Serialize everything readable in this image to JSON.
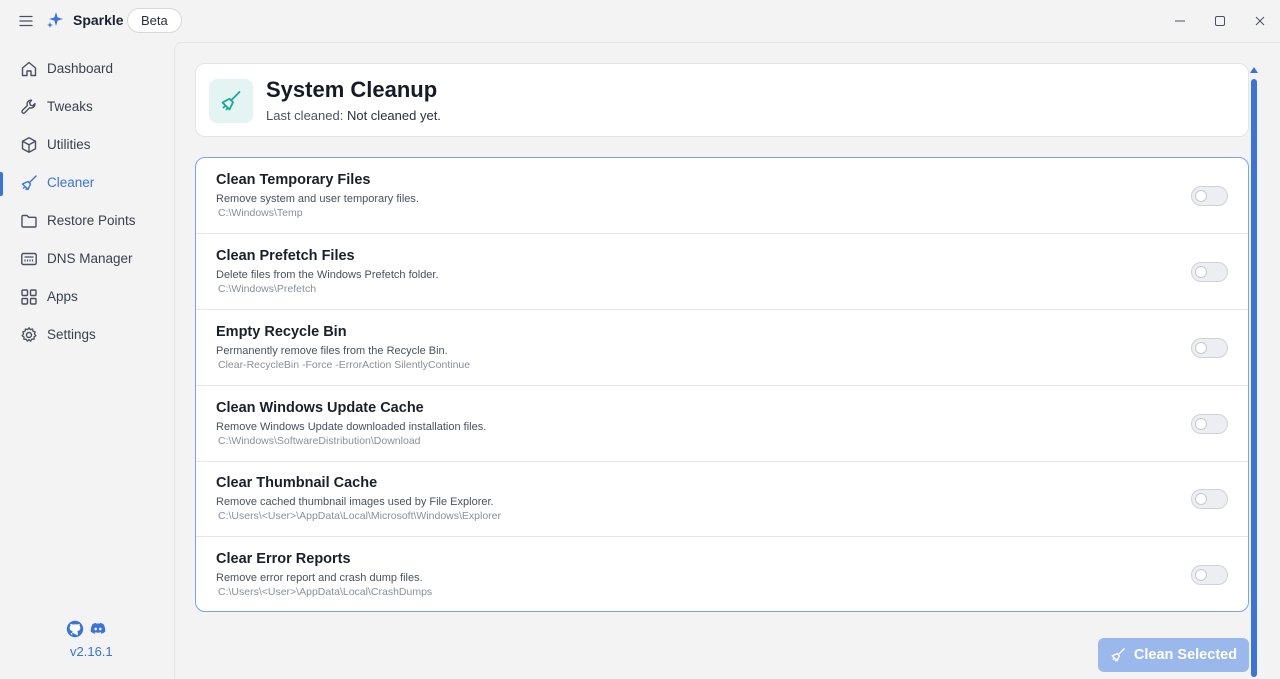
{
  "app": {
    "name": "Sparkle",
    "badge": "Beta",
    "version": "v2.16.1"
  },
  "colors": {
    "accent": "#3b74d9",
    "icon_teal": "#1aa897",
    "button_disabled": "#9ab8ec"
  },
  "sidebar": {
    "items": [
      {
        "label": "Dashboard",
        "icon": "home-icon",
        "active": false
      },
      {
        "label": "Tweaks",
        "icon": "wrench-icon",
        "active": false
      },
      {
        "label": "Utilities",
        "icon": "box-icon",
        "active": false
      },
      {
        "label": "Cleaner",
        "icon": "broom-icon",
        "active": true
      },
      {
        "label": "Restore Points",
        "icon": "folder-icon",
        "active": false
      },
      {
        "label": "DNS Manager",
        "icon": "router-icon",
        "active": false
      },
      {
        "label": "Apps",
        "icon": "grid-icon",
        "active": false
      },
      {
        "label": "Settings",
        "icon": "gear-icon",
        "active": false
      }
    ],
    "social": [
      "github-icon",
      "discord-icon"
    ]
  },
  "header": {
    "title": "System Cleanup",
    "sub_label": "Last cleaned:",
    "sub_value": "Not cleaned yet."
  },
  "options": [
    {
      "title": "Clean Temporary Files",
      "desc": "Remove system and user temporary files.",
      "path": "C:\\Windows\\Temp",
      "enabled": false
    },
    {
      "title": "Clean Prefetch Files",
      "desc": "Delete files from the Windows Prefetch folder.",
      "path": "C:\\Windows\\Prefetch",
      "enabled": false
    },
    {
      "title": "Empty Recycle Bin",
      "desc": "Permanently remove files from the Recycle Bin.",
      "path": "Clear-RecycleBin -Force -ErrorAction SilentlyContinue",
      "enabled": false
    },
    {
      "title": "Clean Windows Update Cache",
      "desc": "Remove Windows Update downloaded installation files.",
      "path": "C:\\Windows\\SoftwareDistribution\\Download",
      "enabled": false
    },
    {
      "title": "Clear Thumbnail Cache",
      "desc": "Remove cached thumbnail images used by File Explorer.",
      "path": "C:\\Users\\<User>\\AppData\\Local\\Microsoft\\Windows\\Explorer",
      "enabled": false
    },
    {
      "title": "Clear Error Reports",
      "desc": "Remove error report and crash dump files.",
      "path": "C:\\Users\\<User>\\AppData\\Local\\CrashDumps",
      "enabled": false
    }
  ],
  "actions": {
    "clean_label": "Clean Selected"
  }
}
